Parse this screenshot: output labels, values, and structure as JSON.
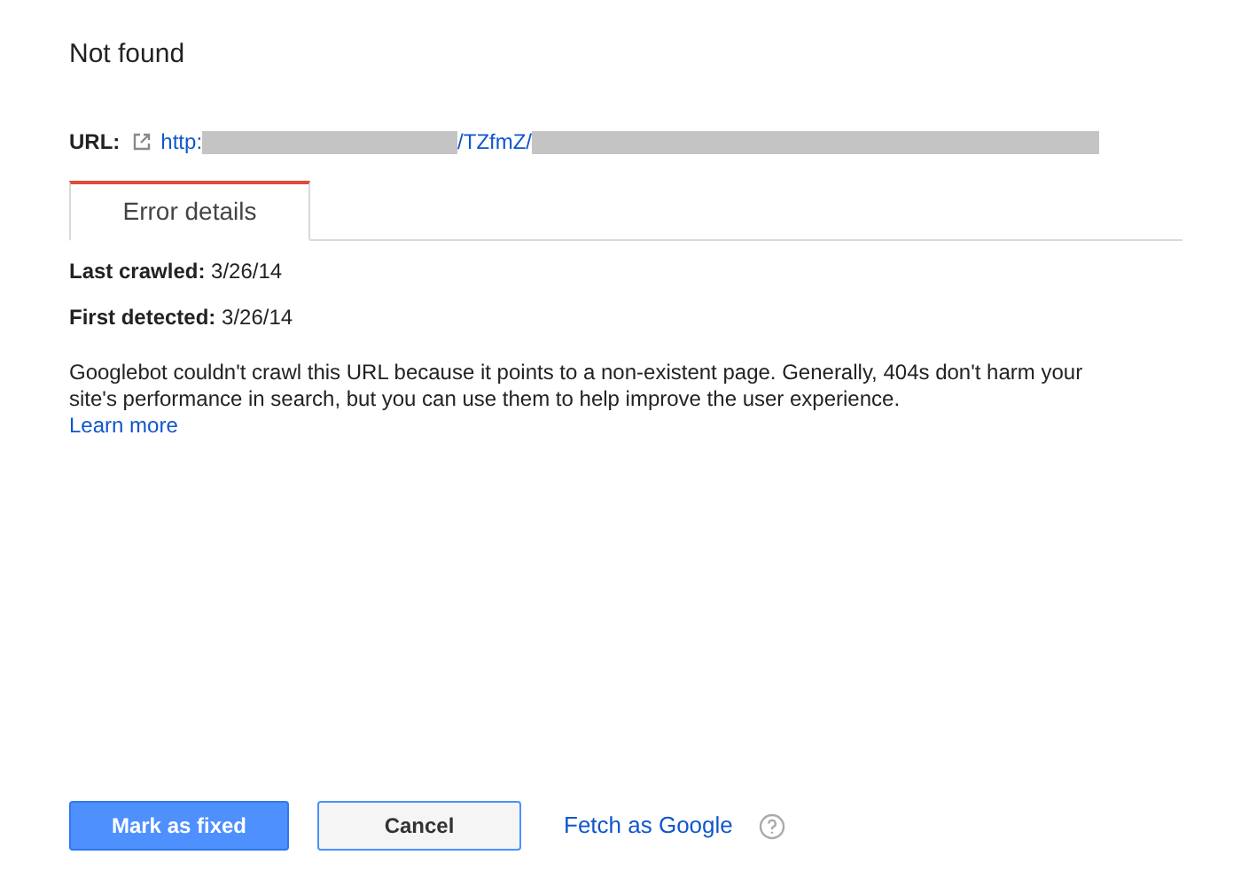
{
  "title": "Not found",
  "url": {
    "label": "URL:",
    "segments": [
      {
        "kind": "text",
        "text": "http:"
      },
      {
        "kind": "short_redaction"
      },
      {
        "kind": "text",
        "text": "/TZfmZ/"
      },
      {
        "kind": "long_redaction"
      }
    ]
  },
  "tabs": [
    {
      "label": "Error details",
      "selected": true
    }
  ],
  "details": [
    {
      "label": "Last crawled:",
      "value": "3/26/14"
    },
    {
      "label": "First detected:",
      "value": "3/26/14"
    }
  ],
  "description": "Googlebot couldn't crawl this URL because it points to a non-existent page. Generally, 404s don't harm your site's performance in search, but you can use them to help improve the user experience.",
  "learn_more": "Learn more",
  "buttons": [
    {
      "label": "Mark as fixed",
      "kind": "primary"
    },
    {
      "label": "Cancel",
      "kind": "secondary"
    }
  ],
  "fetch_link": "Fetch as Google"
}
